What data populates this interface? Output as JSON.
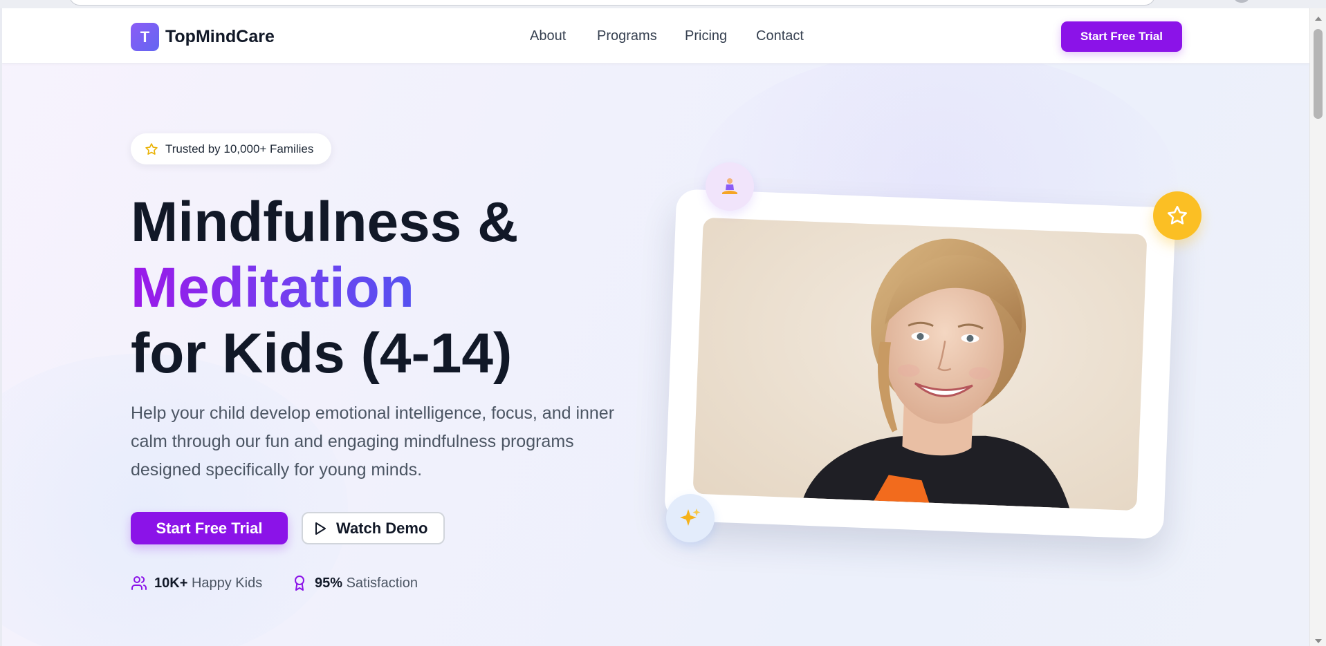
{
  "brand": {
    "logo_letter": "T",
    "name": "TopMindCare"
  },
  "nav": {
    "items": [
      {
        "label": "About"
      },
      {
        "label": "Programs"
      },
      {
        "label": "Pricing"
      },
      {
        "label": "Contact"
      }
    ],
    "cta_label": "Start Free Trial"
  },
  "hero": {
    "badge": "Trusted by 10,000+ Families",
    "title_line1": "Mindfulness &",
    "title_highlight": "Meditation",
    "title_line3": "for Kids (4-14)",
    "subtitle": "Help your child develop emotional intelligence, focus, and inner calm through our fun and engaging mindfulness programs designed specifically for young minds.",
    "primary_cta": "Start Free Trial",
    "secondary_cta": "Watch Demo",
    "stats": [
      {
        "value": "10K+",
        "label": "Happy Kids",
        "icon": "users-icon"
      },
      {
        "value": "95%",
        "label": "Satisfaction",
        "icon": "award-icon"
      }
    ]
  },
  "colors": {
    "accent": "#8b13e8",
    "gradient_start": "#9b18e9",
    "gradient_end": "#3b5ff0",
    "star_badge": "#fbbf24"
  }
}
